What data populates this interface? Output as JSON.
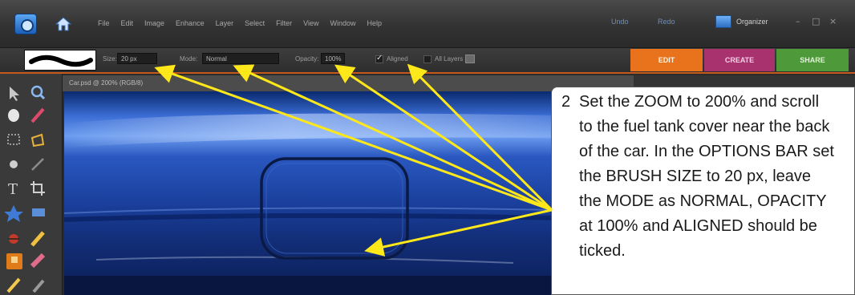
{
  "menubar": {
    "menu_items": [
      "File",
      "Edit",
      "Image",
      "Enhance",
      "Layer",
      "Select",
      "Filter",
      "View",
      "Window",
      "Help"
    ],
    "undo_label": "Undo",
    "redo_label": "Redo",
    "organizer_label": "Organizer",
    "minimize": "–",
    "restore": "□",
    "close": "×"
  },
  "options_bar": {
    "size_label": "Size:",
    "size_value": "20 px",
    "mode_label": "Mode:",
    "mode_value": "Normal",
    "opacity_label": "Opacity:",
    "opacity_value": "100%",
    "aligned_label": "Aligned",
    "aligned_checked": true,
    "all_layers_label": "All Layers",
    "all_layers_checked": false
  },
  "mode_tabs": [
    {
      "label": "EDIT",
      "color": "#e8731c"
    },
    {
      "label": "CREATE",
      "color": "#a8326e"
    },
    {
      "label": "SHARE",
      "color": "#4e9a3a"
    }
  ],
  "document": {
    "tab_title": "Car.psd @ 200% (RGB/8)"
  },
  "tools": [
    "move-icon",
    "zoom-icon",
    "hand-icon",
    "eyedropper-icon",
    "marquee-icon",
    "lasso-icon",
    "quick-selection-icon",
    "magic-wand-icon",
    "type-icon",
    "crop-icon",
    "cookie-cutter-icon",
    "straighten-icon",
    "red-eye-icon",
    "healing-brush-icon",
    "clone-stamp-icon",
    "eraser-icon",
    "brush-icon",
    "smart-brush-icon"
  ],
  "callout": {
    "number": "2",
    "lines": [
      "Set the ZOOM to 200% and scroll",
      "to the fuel tank cover near the back",
      "of the car. In the OPTIONS BAR set",
      "the BRUSH SIZE to 20 px, leave",
      "the MODE as NORMAL, OPACITY",
      "at 100% and ALIGNED should be",
      "ticked."
    ]
  },
  "colors": {
    "accent_orange": "#c55a1c",
    "arrow_yellow": "#ffe81a",
    "car_blue": "#1a3f9c"
  }
}
